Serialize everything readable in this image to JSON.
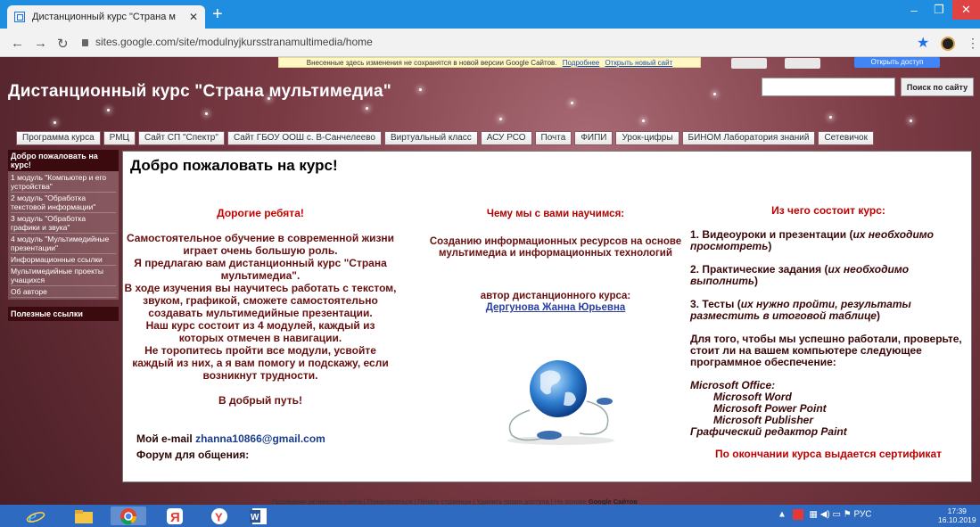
{
  "browser": {
    "tab_title": "Дистанционный курс \"Страна м",
    "tab_close": "✕",
    "new_tab": "+",
    "url": "sites.google.com/site/modulnyjkursstranamultimedia/home",
    "window_min": "–",
    "window_max": "❐",
    "window_close": "✕"
  },
  "notice": {
    "text": "Внесенные здесь изменения не сохранятся в новой версии Google Сайтов.",
    "more_link": "Подробнее",
    "open_link": "Открыть новый сайт"
  },
  "top_share": "Открыть доступ",
  "site": {
    "title": "Дистанционный курс \"Страна мультимедиа\"",
    "search_button": "Поиск по сайту",
    "search_placeholder": ""
  },
  "nav": [
    "Программа курса",
    "РМЦ",
    "Сайт СП \"Спектр\"",
    "Сайт ГБОУ ООШ с. В-Санчелеево",
    "Виртуальный класс",
    "АСУ РСО",
    "Почта",
    "ФИПИ",
    "Урок-цифры",
    "БИНОМ Лаборатория знаний",
    "Сетевичок"
  ],
  "sidebar": {
    "header": "Добро пожаловать на курс!",
    "items": [
      "1 модуль \"Компьютер и его устройства\"",
      "2 модуль \"Обработка текстовой информации\"",
      "3 модуль \"Обработка графики и звука\"",
      "4 модуль \"Мультимедийные презентации\"",
      "Информационные ссылки",
      "Мультимедийные проекты учащихся",
      "Об авторе"
    ],
    "header2": "Полезные ссылки"
  },
  "main": {
    "heading": "Добро пожаловать на курс!",
    "col1": {
      "heading": "Дорогие ребята!",
      "p1": "Самостоятельное обучение в современной жизни играет очень большую роль.",
      "p2": "Я предлагаю вам дистанционный курс \"Страна мультимедиа\".",
      "p3": "В ходе изучения вы научитесь работать  с текстом, звуком, графикой, сможете самостоятельно создавать мультимедийные презентации.",
      "p4": "Наш курс состоит из 4 модулей, каждый из которых отмечен в навигации.",
      "p5": "Не торопитесь пройти  все модули, усвойте каждый из них, а я вам помогу и подскажу, если возникнут трудности.",
      "wish": "В добрый путь!",
      "email_label": "Мой e-mail",
      "email": "zhanna10866@gmail.com",
      "forum": "Форум для общения:"
    },
    "col2": {
      "heading": "Чему мы с вами научимся:",
      "text": "Созданию информационных ресурсов на основе мультимедиа и информационных технологий",
      "author_label": "автор дистанционного курса:",
      "author": "Дергунова Жанна Юрьевна"
    },
    "col3": {
      "heading": "Из чего  состоит курс:",
      "i1": "1. Видеоуроки и презентации (",
      "i1_it": "их необходимо просмотреть",
      "i2": "2. Практические задания (",
      "i2_it": "их необходимо выполнить",
      "i3": "3. Тесты (",
      "i3_it": "их нужно пройти, результаты разместить в итоговой таблице",
      "close": ")",
      "check": "Для того, чтобы мы успешно работали, проверьте, стоит ли на вашем компьютере следующее программное обеспечение:",
      "s0": "Microsoft Office:",
      "s1": "Microsoft Word",
      "s2": "Microsoft Power Point",
      "s3": "Microsoft Publisher",
      "s4": "Графический редактор Paint",
      "cert": "По окончании курса выдается сертификат"
    }
  },
  "footer": {
    "text": "Последняя активность сайта | Пожаловаться | Печать страницы | Удалить право доступа | На основе",
    "brand": "Google Сайтов"
  },
  "taskbar": {
    "tray": "РУС",
    "time": "17:39",
    "date": "16.10.2019"
  }
}
